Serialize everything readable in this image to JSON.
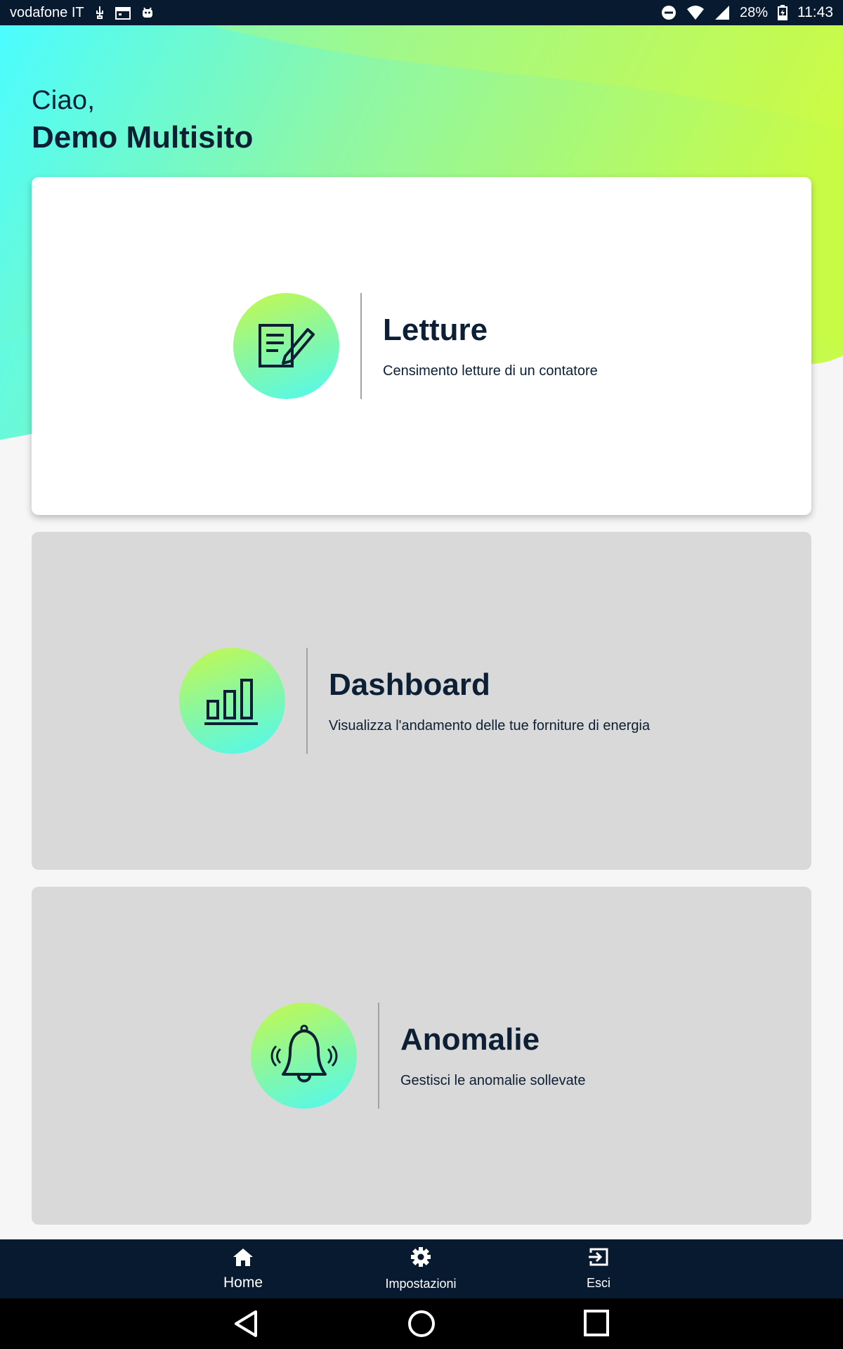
{
  "status_bar": {
    "carrier": "vodafone IT",
    "battery": "28%",
    "time": "11:43"
  },
  "header": {
    "greeting": "Ciao,",
    "user_name": "Demo Multisito"
  },
  "cards": [
    {
      "title": "Letture",
      "description": "Censimento letture di un contatore",
      "icon": "edit-document-icon",
      "active": true
    },
    {
      "title": "Dashboard",
      "description": "Visualizza l'andamento delle tue forniture di energia",
      "icon": "bar-chart-icon",
      "active": false
    },
    {
      "title": "Anomalie",
      "description": "Gestisci le anomalie sollevate",
      "icon": "bell-icon",
      "active": false
    }
  ],
  "bottom_nav": {
    "items": [
      {
        "label": "Home",
        "icon": "home-icon"
      },
      {
        "label": "Impostazioni",
        "icon": "gear-icon"
      },
      {
        "label": "Esci",
        "icon": "logout-icon"
      }
    ]
  },
  "colors": {
    "navy": "#071a2f",
    "text": "#0c1f35",
    "gradient_cyan": "#4ef8f4",
    "gradient_lime": "#c7f94a",
    "card_inactive": "#d9d9d9"
  }
}
